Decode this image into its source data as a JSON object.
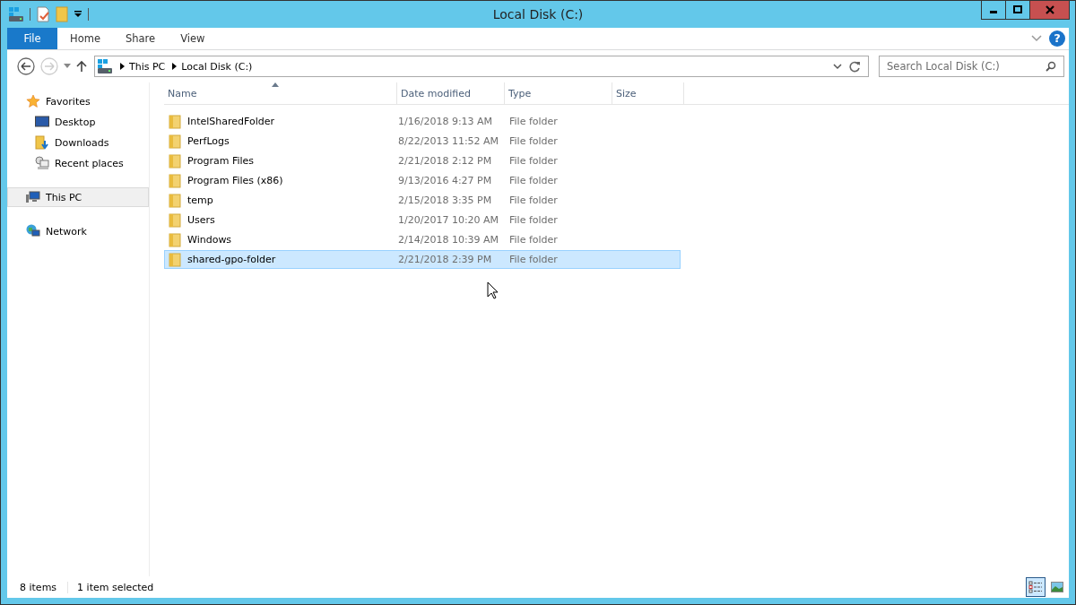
{
  "window": {
    "title": "Local Disk (C:)"
  },
  "ribbon_tabs": [
    {
      "label": "File",
      "kind": "file",
      "selected": false
    },
    {
      "label": "Home",
      "kind": "tab",
      "selected": false
    },
    {
      "label": "Share",
      "kind": "tab",
      "selected": false
    },
    {
      "label": "View",
      "kind": "tab",
      "selected": false
    }
  ],
  "help": {
    "label": "?"
  },
  "address_bar": {
    "crumbs": [
      "This PC",
      "Local Disk (C:)"
    ]
  },
  "search": {
    "placeholder": "Search Local Disk (C:)"
  },
  "sidebar": {
    "items": [
      {
        "label": "Favorites",
        "kind": "favorites",
        "selected": false,
        "children": [
          {
            "label": "Desktop",
            "kind": "desktop",
            "selected": false
          },
          {
            "label": "Downloads",
            "kind": "downloads",
            "selected": false
          },
          {
            "label": "Recent places",
            "kind": "recent",
            "selected": false
          }
        ]
      },
      {
        "label": "This PC",
        "kind": "pc",
        "selected": true
      },
      {
        "label": "Network",
        "kind": "network",
        "selected": false
      }
    ]
  },
  "table": {
    "columns": [
      "Name",
      "Date modified",
      "Type",
      "Size"
    ],
    "rows": [
      {
        "name": "IntelSharedFolder",
        "date": "1/16/2018 9:13 AM",
        "type": "File folder",
        "selected": false
      },
      {
        "name": "PerfLogs",
        "date": "8/22/2013 11:52 AM",
        "type": "File folder",
        "selected": false
      },
      {
        "name": "Program Files",
        "date": "2/21/2018 2:12 PM",
        "type": "File folder",
        "selected": false
      },
      {
        "name": "Program Files (x86)",
        "date": "9/13/2016 4:27 PM",
        "type": "File folder",
        "selected": false
      },
      {
        "name": "temp",
        "date": "2/15/2018 3:35 PM",
        "type": "File folder",
        "selected": false
      },
      {
        "name": "Users",
        "date": "1/20/2017 10:20 AM",
        "type": "File folder",
        "selected": false
      },
      {
        "name": "Windows",
        "date": "2/14/2018 10:39 AM",
        "type": "File folder",
        "selected": false
      },
      {
        "name": "shared-gpo-folder",
        "date": "2/21/2018 2:39 PM",
        "type": "File folder",
        "selected": true
      }
    ]
  },
  "status_bar": {
    "item_count": "8 items",
    "selection": "1 item selected"
  }
}
